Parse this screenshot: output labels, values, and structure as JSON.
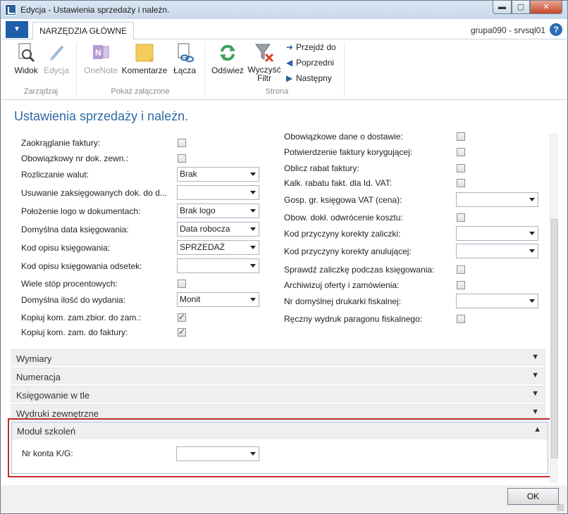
{
  "window": {
    "title": "Edycja - Ustawienia sprzedaży i należn.",
    "minimize": "▬",
    "maximize": "▢",
    "close": "✕"
  },
  "ribbon": {
    "menu_glyph": "▼",
    "tab_main": "NARZĘDZIA GŁÓWNE",
    "server": "grupa090 - srvsql01",
    "help": "?",
    "groups": {
      "manage": "Zarządzaj",
      "attachments": "Pokaż załączone",
      "page": "Strona"
    },
    "buttons": {
      "view": "Widok",
      "edit": "Edycja",
      "onenote": "OneNote",
      "comments": "Komentarze",
      "links": "Łącza",
      "refresh": "Odśwież",
      "clear_filter_line1": "Wyczyść",
      "clear_filter_line2": "Filtr",
      "goto": "Przejdź do",
      "previous": "Poprzedni",
      "next": "Następny"
    }
  },
  "page": {
    "title": "Ustawienia sprzedaży i należn."
  },
  "left_fields": [
    {
      "label": "Zaokrąglanie faktury:",
      "type": "checkbox",
      "checked": false
    },
    {
      "label": "Obowiązkowy nr dok. zewn.:",
      "type": "checkbox",
      "checked": false
    },
    {
      "label": "Rozliczanie walut:",
      "type": "dropdown",
      "value": "Brak"
    },
    {
      "label": "Usuwanie zaksięgowanych dok. do d...",
      "type": "dropdown",
      "value": ""
    },
    {
      "label": "Położenie logo w dokumentach:",
      "type": "dropdown",
      "value": "Brak logo"
    },
    {
      "label": "Domyślna data księgowania:",
      "type": "dropdown",
      "value": "Data robocza"
    },
    {
      "label": "Kod opisu księgowania:",
      "type": "dropdown",
      "value": "SPRZEDAŻ"
    },
    {
      "label": "Kod opisu księgowania odsetek:",
      "type": "dropdown",
      "value": ""
    },
    {
      "label": "Wiele stóp procentowych:",
      "type": "checkbox",
      "checked": false
    },
    {
      "label": "Domyślna ilość do wydania:",
      "type": "dropdown",
      "value": "Monit"
    },
    {
      "label": "Kopiuj kom. zam.zbior. do zam.:",
      "type": "checkbox",
      "checked": true
    },
    {
      "label": "Kopiuj kom. zam. do faktury:",
      "type": "checkbox",
      "checked": true
    }
  ],
  "right_fields": [
    {
      "label": "Obowiązkowe dane o dostawie:",
      "type": "checkbox",
      "checked": false
    },
    {
      "label": "Potwierdzenie faktury korygującej:",
      "type": "checkbox",
      "checked": false
    },
    {
      "label": "Oblicz rabat faktury:",
      "type": "checkbox",
      "checked": false
    },
    {
      "label": "Kalk. rabatu fakt. dla Id. VAT:",
      "type": "checkbox",
      "checked": false
    },
    {
      "label": "Gosp. gr. księgowa VAT (cena):",
      "type": "dropdown",
      "value": ""
    },
    {
      "label": "Obow. dokł. odwrócenie kosztu:",
      "type": "checkbox",
      "checked": false
    },
    {
      "label": "Kod przyczyny korekty zaliczki:",
      "type": "dropdown",
      "value": ""
    },
    {
      "label": "Kod przyczyny korekty anulującej:",
      "type": "dropdown",
      "value": ""
    },
    {
      "label": "Sprawdź zaliczkę podczas księgowania:",
      "type": "checkbox",
      "checked": false
    },
    {
      "label": "Archiwizuj oferty i zamówienia:",
      "type": "checkbox",
      "checked": false
    },
    {
      "label": "Nr domyślnej drukarki fiskalnej:",
      "type": "dropdown",
      "value": ""
    },
    {
      "label": "Ręczny wydruk paragonu fiskalnego:",
      "type": "checkbox",
      "checked": false
    }
  ],
  "fasttabs": [
    {
      "label": "Wymiary",
      "expanded": false
    },
    {
      "label": "Numeracja",
      "expanded": false
    },
    {
      "label": "Księgowanie w tle",
      "expanded": false
    },
    {
      "label": "Wydruki zewnętrzne",
      "expanded": false
    }
  ],
  "modul": {
    "title": "Moduł szkoleń",
    "field_label": "Nr konta K/G:",
    "field_value": ""
  },
  "footer": {
    "ok": "OK"
  },
  "colors": {
    "title_blue": "#2f6aa6",
    "highlight_red": "#c22a31",
    "menu_blue": "#1f5fa9"
  }
}
